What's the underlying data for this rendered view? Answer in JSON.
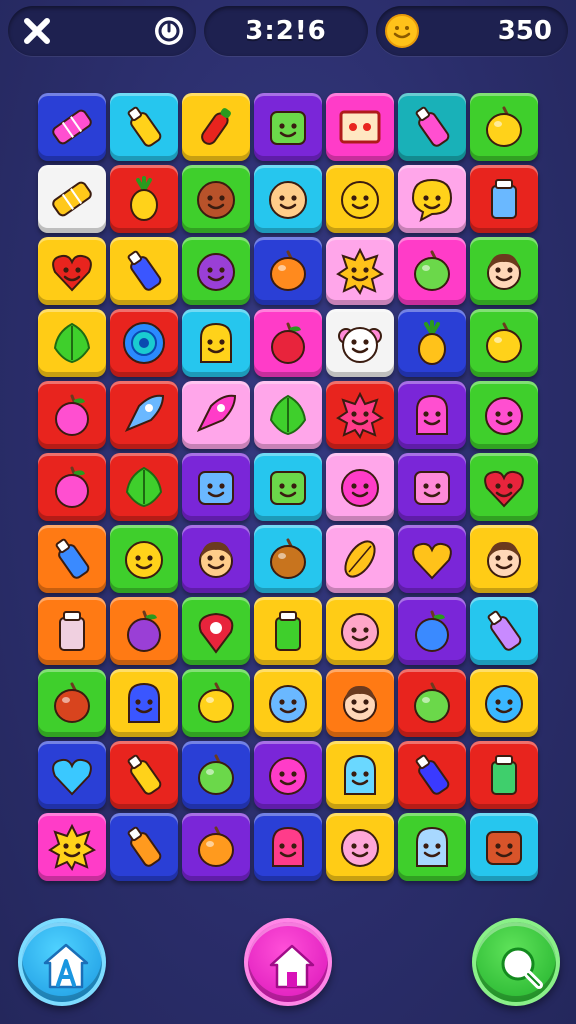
{
  "hud": {
    "timer": "3:2!6",
    "coins": "350",
    "close_icon": "close-x-icon",
    "timer_icon": "stopwatch-icon",
    "coin_icon": "smiley-coin-icon"
  },
  "colors": {
    "background": "#2b2f6e",
    "hud_pill": "#1e2150",
    "tile_palette": {
      "blue": "#2a3fd6",
      "cyan": "#26c6ee",
      "yellow": "#ffcc16",
      "purple": "#7a26d8",
      "pink": "#ff3cc8",
      "teal": "#19b1b8",
      "green": "#3fcf2c",
      "white": "#f4f4f4",
      "red": "#e8241e",
      "lightpink": "#ffa6ea",
      "orange": "#ff7a14"
    }
  },
  "board": {
    "columns": 7,
    "rows": [
      [
        {
          "color": "blue",
          "icon": "eraser-icon",
          "icon_color": "#ff4fd0"
        },
        {
          "color": "cyan",
          "icon": "bottle-icon",
          "icon_color": "#ffd21a"
        },
        {
          "color": "yellow",
          "icon": "chili-icon",
          "icon_color": "#e8241e"
        },
        {
          "color": "purple",
          "icon": "robot-icon",
          "icon_color": "#6bd84a"
        },
        {
          "color": "pink",
          "icon": "picture-frame-icon",
          "icon_color": "#ffe7c2"
        },
        {
          "color": "teal",
          "icon": "bottle-icon",
          "icon_color": "#ff4fd0"
        },
        {
          "color": "green",
          "icon": "lemon-icon",
          "icon_color": "#ffd21a"
        }
      ],
      [
        {
          "color": "white",
          "icon": "bandage-icon",
          "icon_color": "#ffc81a"
        },
        {
          "color": "red",
          "icon": "pineapple-icon",
          "icon_color": "#ffd21a"
        },
        {
          "color": "green",
          "icon": "face-icon",
          "icon_color": "#b8522a"
        },
        {
          "color": "cyan",
          "icon": "face-icon",
          "icon_color": "#ffcd8a"
        },
        {
          "color": "yellow",
          "icon": "smiley-icon",
          "icon_color": "#ffd21a"
        },
        {
          "color": "lightpink",
          "icon": "speech-bubble-icon",
          "icon_color": "#ffd21a"
        },
        {
          "color": "red",
          "icon": "juice-box-icon",
          "icon_color": "#6ab8ff"
        }
      ],
      [
        {
          "color": "yellow",
          "icon": "heart-face-icon",
          "icon_color": "#e8241e"
        },
        {
          "color": "yellow",
          "icon": "bottle-icon",
          "icon_color": "#3a56ff"
        },
        {
          "color": "green",
          "icon": "face-icon",
          "icon_color": "#9a3fd6"
        },
        {
          "color": "blue",
          "icon": "fruit-icon",
          "icon_color": "#ff8a1e"
        },
        {
          "color": "lightpink",
          "icon": "sun-face-icon",
          "icon_color": "#ffc21a"
        },
        {
          "color": "pink",
          "icon": "fruit-icon",
          "icon_color": "#6bd84a"
        },
        {
          "color": "green",
          "icon": "girl-face-icon",
          "icon_color": "#ffd7b8"
        }
      ],
      [
        {
          "color": "yellow",
          "icon": "leaf-icon",
          "icon_color": "#3fcf2c"
        },
        {
          "color": "red",
          "icon": "target-icon",
          "icon_color": "#2a8aff"
        },
        {
          "color": "cyan",
          "icon": "bell-face-icon",
          "icon_color": "#ffd21a"
        },
        {
          "color": "pink",
          "icon": "berry-icon",
          "icon_color": "#e8243c"
        },
        {
          "color": "white",
          "icon": "monkey-face-icon",
          "icon_color": "#ff8ad8"
        },
        {
          "color": "blue",
          "icon": "pineapple-icon",
          "icon_color": "#ffc21a"
        },
        {
          "color": "green",
          "icon": "lemon-icon",
          "icon_color": "#ffd21a"
        }
      ],
      [
        {
          "color": "red",
          "icon": "apple-icon",
          "icon_color": "#ff4fd0"
        },
        {
          "color": "red",
          "icon": "feather-icon",
          "icon_color": "#6ab8ff"
        },
        {
          "color": "lightpink",
          "icon": "rocket-icon",
          "icon_color": "#ff3cc8"
        },
        {
          "color": "lightpink",
          "icon": "leaf-icon",
          "icon_color": "#3fcf2c"
        },
        {
          "color": "red",
          "icon": "fluffy-monster-icon",
          "icon_color": "#ff3c8a"
        },
        {
          "color": "purple",
          "icon": "monster-icon",
          "icon_color": "#ff4fd0"
        },
        {
          "color": "green",
          "icon": "blob-face-icon",
          "icon_color": "#ff4fd0"
        }
      ],
      [
        {
          "color": "red",
          "icon": "apple-icon",
          "icon_color": "#ff4fd0"
        },
        {
          "color": "red",
          "icon": "leaf-icon",
          "icon_color": "#3fcf2c"
        },
        {
          "color": "purple",
          "icon": "box-face-icon",
          "icon_color": "#6ab8ff"
        },
        {
          "color": "cyan",
          "icon": "box-face-icon",
          "icon_color": "#6bd84a"
        },
        {
          "color": "lightpink",
          "icon": "bird-face-icon",
          "icon_color": "#ff3cc8"
        },
        {
          "color": "purple",
          "icon": "box-face-icon",
          "icon_color": "#ff8ad8"
        },
        {
          "color": "green",
          "icon": "heart-face-icon",
          "icon_color": "#e8243c"
        }
      ],
      [
        {
          "color": "orange",
          "icon": "bottle-icon",
          "icon_color": "#3a8aff"
        },
        {
          "color": "green",
          "icon": "face-icon",
          "icon_color": "#ffd21a"
        },
        {
          "color": "purple",
          "icon": "boy-face-icon",
          "icon_color": "#ffcd8a"
        },
        {
          "color": "cyan",
          "icon": "fruit-icon",
          "icon_color": "#c8741e"
        },
        {
          "color": "lightpink",
          "icon": "cocoa-pod-icon",
          "icon_color": "#ffc21a"
        },
        {
          "color": "purple",
          "icon": "heart-icon",
          "icon_color": "#ffc21a"
        },
        {
          "color": "yellow",
          "icon": "girl-face-icon",
          "icon_color": "#ffd7b8"
        }
      ],
      [
        {
          "color": "orange",
          "icon": "jar-icon",
          "icon_color": "#f0d0e0"
        },
        {
          "color": "orange",
          "icon": "berry-icon",
          "icon_color": "#9a3fd6"
        },
        {
          "color": "green",
          "icon": "location-pin-icon",
          "icon_color": "#e8243c"
        },
        {
          "color": "yellow",
          "icon": "juice-box-icon",
          "icon_color": "#3fcf2c"
        },
        {
          "color": "yellow",
          "icon": "face-icon",
          "icon_color": "#ffa6c8"
        },
        {
          "color": "purple",
          "icon": "berry-icon",
          "icon_color": "#3a8aff"
        },
        {
          "color": "cyan",
          "icon": "paint-tube-icon",
          "icon_color": "#c88aff"
        }
      ],
      [
        {
          "color": "green",
          "icon": "fruit-icon",
          "icon_color": "#d8441e"
        },
        {
          "color": "yellow",
          "icon": "monster-icon",
          "icon_color": "#3a56ff"
        },
        {
          "color": "green",
          "icon": "lemon-icon",
          "icon_color": "#ffd21a"
        },
        {
          "color": "yellow",
          "icon": "smiley-icon",
          "icon_color": "#6ab8ff"
        },
        {
          "color": "orange",
          "icon": "girl-face-icon",
          "icon_color": "#ffd7b8"
        },
        {
          "color": "red",
          "icon": "lime-icon",
          "icon_color": "#6bd84a"
        },
        {
          "color": "yellow",
          "icon": "smiley-icon",
          "icon_color": "#3ab8ff"
        }
      ],
      [
        {
          "color": "blue",
          "icon": "heart-icon",
          "icon_color": "#3ac8ff"
        },
        {
          "color": "red",
          "icon": "ice-pop-icon",
          "icon_color": "#ffd21a"
        },
        {
          "color": "blue",
          "icon": "lime-icon",
          "icon_color": "#6bd84a"
        },
        {
          "color": "purple",
          "icon": "smiley-icon",
          "icon_color": "#ff3cc8"
        },
        {
          "color": "yellow",
          "icon": "robot-face-icon",
          "icon_color": "#6ad8ff"
        },
        {
          "color": "red",
          "icon": "crayon-icon",
          "icon_color": "#3a3aff"
        },
        {
          "color": "red",
          "icon": "juice-box-icon",
          "icon_color": "#3fcf6c"
        }
      ],
      [
        {
          "color": "pink",
          "icon": "star-face-icon",
          "icon_color": "#ffd21a"
        },
        {
          "color": "blue",
          "icon": "bottle-icon",
          "icon_color": "#ff9a1e"
        },
        {
          "color": "purple",
          "icon": "fruit-icon",
          "icon_color": "#ff9a1e"
        },
        {
          "color": "blue",
          "icon": "monster-icon",
          "icon_color": "#ff3c8a"
        },
        {
          "color": "yellow",
          "icon": "smiley-icon",
          "icon_color": "#ffa6d8"
        },
        {
          "color": "green",
          "icon": "robot-face-icon",
          "icon_color": "#a8d8ff"
        },
        {
          "color": "cyan",
          "icon": "box-face-icon",
          "icon_color": "#d8542a"
        }
      ]
    ]
  },
  "bottom_buttons": [
    {
      "name": "profile-button",
      "icon": "a-house-icon"
    },
    {
      "name": "home-button",
      "icon": "home-icon"
    },
    {
      "name": "search-button",
      "icon": "search-icon"
    }
  ]
}
